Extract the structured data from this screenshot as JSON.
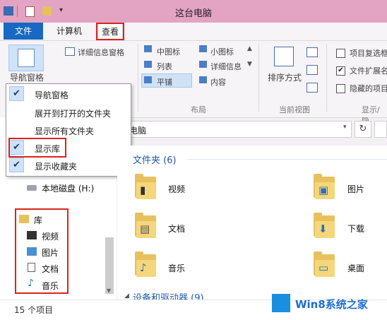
{
  "window": {
    "title": "这台电脑"
  },
  "tabs": [
    {
      "label": "文件"
    },
    {
      "label": "计算机"
    },
    {
      "label": "查看"
    }
  ],
  "ribbon": {
    "nav_pane_label": "导航窗格",
    "details_pane_label": "详细信息窗格",
    "layout_items": [
      "中图标",
      "小图标",
      "列表",
      "详细信息",
      "平铺",
      "内容"
    ],
    "layout_group": "布局",
    "sort_label": "排序方式",
    "current_view_group": "当前视图",
    "show_items": [
      "项目复选框",
      "文件扩展名",
      "隐藏的项目"
    ],
    "show_group": "显示/隐"
  },
  "menu": {
    "items": [
      {
        "label": "导航窗格",
        "checked": true
      },
      {
        "label": "展开到打开的文件夹",
        "checked": false
      },
      {
        "label": "显示所有文件夹",
        "checked": false
      },
      {
        "label": "显示库",
        "checked": true
      },
      {
        "label": "显示收藏夹",
        "checked": true
      }
    ]
  },
  "address": {
    "path": "电脑"
  },
  "nav": {
    "drive": "本地磁盘 (H:)",
    "library": "库",
    "library_items": [
      "视频",
      "图片",
      "文档",
      "音乐"
    ]
  },
  "content": {
    "folders_header": "文件夹 (6)",
    "folders": [
      "视频",
      "图片",
      "文档",
      "下载",
      "音乐",
      "桌面"
    ],
    "devices_header": "设备和驱动器 (9)"
  },
  "status": {
    "item_count": "15 个项目"
  },
  "watermark": {
    "text": "Win8系统之家"
  },
  "colors": {
    "title_bar": "#e3a3c3",
    "file_tab": "#1769c4",
    "highlight": "#d9241c",
    "header_blue": "#1e5aa8"
  }
}
